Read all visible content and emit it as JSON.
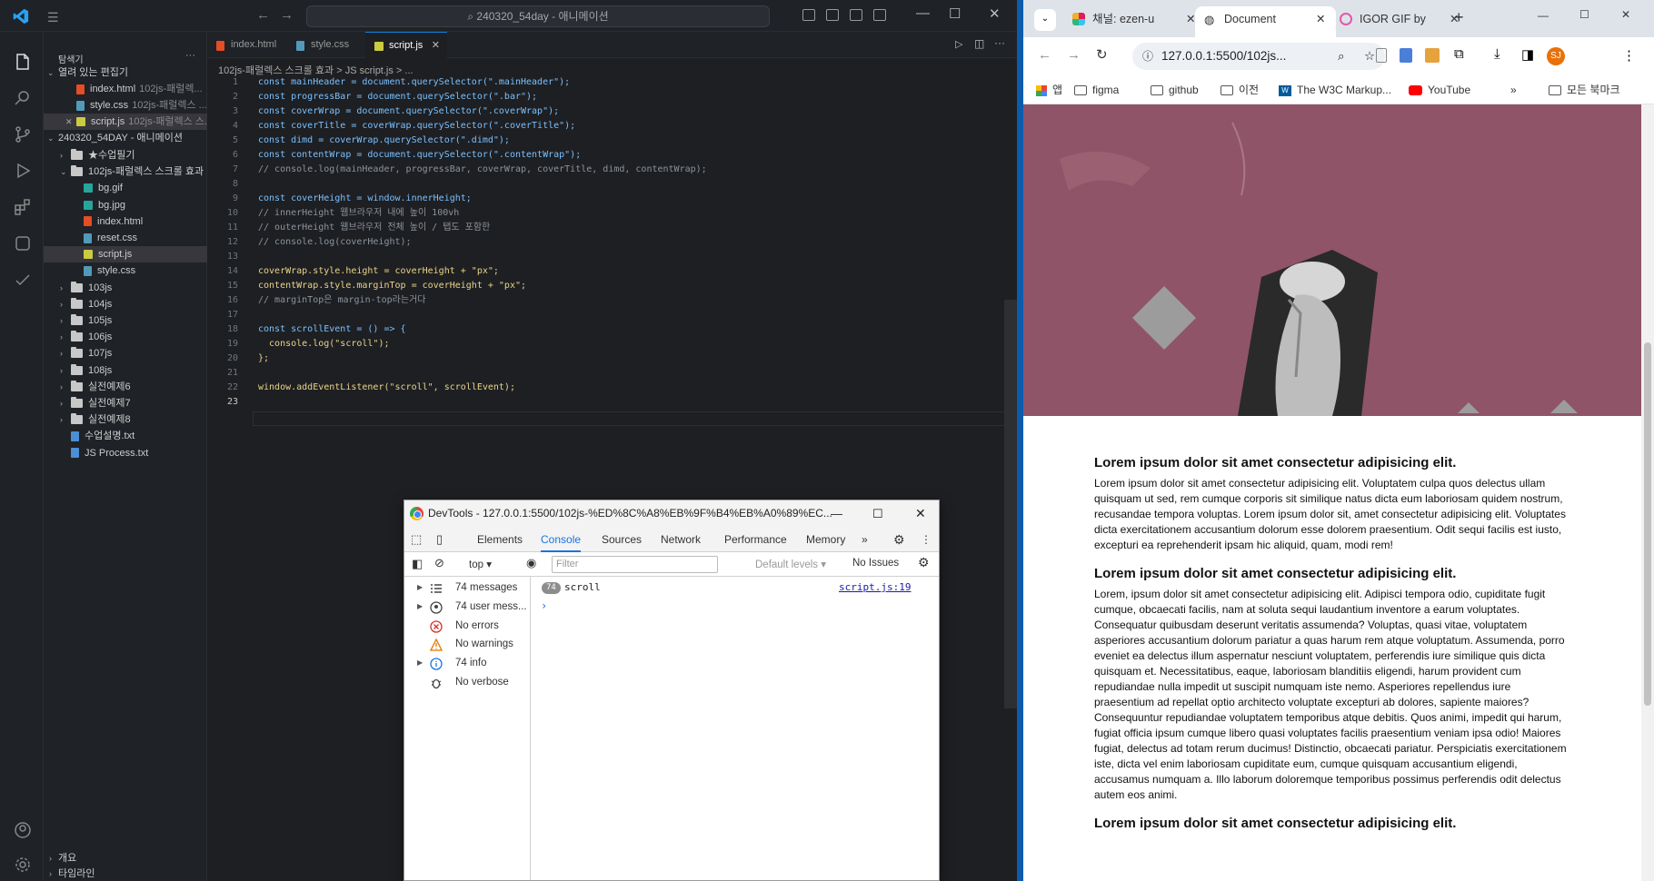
{
  "vscode": {
    "search": "240320_54day - 애니메이션",
    "sidebar": {
      "title": "탐색기",
      "open_editors_label": "열려 있는 편집기",
      "open_editors": [
        {
          "name": "index.html",
          "hint": "102js-패럴렉..."
        },
        {
          "name": "style.css",
          "hint": "102js-패럴렉스 ..."
        },
        {
          "name": "script.js",
          "hint": "102js-패럴렉스 스..."
        }
      ],
      "workspace_label": "240320_54DAY - 애니메이션",
      "tree": [
        {
          "name": "★수업필기",
          "type": "folder",
          "depth": 1
        },
        {
          "name": "102js-패럴렉스 스크롤 효과",
          "type": "folder",
          "depth": 1,
          "open": true
        },
        {
          "name": "bg.gif",
          "type": "img",
          "depth": 2
        },
        {
          "name": "bg.jpg",
          "type": "img",
          "depth": 2
        },
        {
          "name": "index.html",
          "type": "html",
          "depth": 2
        },
        {
          "name": "reset.css",
          "type": "css",
          "depth": 2
        },
        {
          "name": "script.js",
          "type": "js",
          "depth": 2,
          "selected": true
        },
        {
          "name": "style.css",
          "type": "css",
          "depth": 2
        },
        {
          "name": "103js",
          "type": "folder",
          "depth": 1
        },
        {
          "name": "104js",
          "type": "folder",
          "depth": 1
        },
        {
          "name": "105js",
          "type": "folder",
          "depth": 1
        },
        {
          "name": "106js",
          "type": "folder",
          "depth": 1
        },
        {
          "name": "107js",
          "type": "folder",
          "depth": 1
        },
        {
          "name": "108js",
          "type": "folder",
          "depth": 1
        },
        {
          "name": "실전예제6",
          "type": "folder",
          "depth": 1
        },
        {
          "name": "실전예제7",
          "type": "folder",
          "depth": 1
        },
        {
          "name": "실전예제8",
          "type": "folder",
          "depth": 1
        },
        {
          "name": "수업설명.txt",
          "type": "txt",
          "depth": 1
        },
        {
          "name": "JS Process.txt",
          "type": "txt",
          "depth": 1
        }
      ],
      "outline_label": "개요",
      "timeline_label": "타임라인"
    },
    "tabs": [
      {
        "label": "index.html",
        "type": "html"
      },
      {
        "label": "style.css",
        "type": "css"
      },
      {
        "label": "script.js",
        "type": "js",
        "active": true
      }
    ],
    "breadcrumb": "102js-패럴렉스 스크롤 효과 > JS script.js > ...",
    "code_lines": [
      "const mainHeader = document.querySelector(\".mainHeader\");",
      "const progressBar = document.querySelector(\".bar\");",
      "const coverWrap = document.querySelector(\".coverWrap\");",
      "const coverTitle = coverWrap.querySelector(\".coverTitle\");",
      "const dimd = coverWrap.querySelector(\".dimd\");",
      "const contentWrap = document.querySelector(\".contentWrap\");",
      "// console.log(mainHeader, progressBar, coverWrap, coverTitle, dimd, contentWrap);",
      "",
      "const coverHeight = window.innerHeight;",
      "// innerHeight 웹브라우저 내에 높이 100vh",
      "// outerHeight 웹브라우저 전체 높이 / 탭도 포함한",
      "// console.log(coverHeight);",
      "",
      "coverWrap.style.height = coverHeight + \"px\";",
      "contentWrap.style.marginTop = coverHeight + \"px\";",
      "// marginTop은 margin-top라는거다",
      "",
      "const scrollEvent = () => {",
      "  console.log(\"scroll\");",
      "};",
      "",
      "window.addEventListener(\"scroll\", scrollEvent);",
      ""
    ]
  },
  "devtools": {
    "title": "DevTools - 127.0.0.1:5500/102js-%ED%8C%A8%EB%9F%B4%EB%A0%89%EC...",
    "tabs": [
      "Elements",
      "Console",
      "Sources",
      "Network",
      "Performance",
      "Memory"
    ],
    "active_tab": "Console",
    "context": "top",
    "filter_placeholder": "Filter",
    "levels": "Default levels",
    "issues": "No Issues",
    "sidebar": [
      {
        "label": "74 messages",
        "icon": "list-icon"
      },
      {
        "label": "74 user mess...",
        "icon": "user-icon"
      },
      {
        "label": "No errors",
        "icon": "error-icon"
      },
      {
        "label": "No warnings",
        "icon": "warning-icon"
      },
      {
        "label": "74 info",
        "icon": "info-icon"
      },
      {
        "label": "No verbose",
        "icon": "bug-icon"
      }
    ],
    "log": {
      "count": "74",
      "message": "scroll",
      "source": "script.js:19"
    }
  },
  "chrome": {
    "tabs": [
      {
        "label": "채널: ezen-u"
      },
      {
        "label": "Document",
        "active": true
      },
      {
        "label": "IGOR GIF by"
      }
    ],
    "url": "127.0.0.1:5500/102js...",
    "profile": "SJ",
    "bookmarks": [
      "앱",
      "figma",
      "github",
      "이전",
      "The W3C Markup...",
      "YouTube"
    ],
    "all_bookmarks": "모든 북마크",
    "page": {
      "sections": [
        {
          "heading": "Lorem ipsum dolor sit amet consectetur adipisicing elit.",
          "body": "Lorem ipsum dolor sit amet consectetur adipisicing elit. Voluptatem culpa quos delectus ullam quisquam ut sed, rem cumque corporis sit similique natus dicta eum laboriosam quidem nostrum, recusandae tempora voluptas. Lorem ipsum dolor sit, amet consectetur adipisicing elit. Voluptates dicta exercitationem accusantium dolorum esse dolorem praesentium. Odit sequi facilis est iusto, excepturi ea reprehenderit ipsam hic aliquid, quam, modi rem!"
        },
        {
          "heading": "Lorem ipsum dolor sit amet consectetur adipisicing elit.",
          "body": "Lorem, ipsum dolor sit amet consectetur adipisicing elit. Adipisci tempora odio, cupiditate fugit cumque, obcaecati facilis, nam at soluta sequi laudantium inventore a earum voluptates. Consequatur quibusdam deserunt veritatis assumenda? Voluptas, quasi vitae, voluptatem asperiores accusantium dolorum pariatur a quas harum rem atque voluptatum. Assumenda, porro eveniet ea delectus illum aspernatur nesciunt voluptatem, perferendis iure similique quis dicta quisquam et. Necessitatibus, eaque, laboriosam blanditiis eligendi, harum provident cum repudiandae nulla impedit ut suscipit numquam iste nemo. Asperiores repellendus iure praesentium ad repellat optio architecto voluptate excepturi ab dolores, sapiente maiores? Consequuntur repudiandae voluptatem temporibus atque debitis. Quos animi, impedit qui harum, fugiat officia ipsum cumque libero quasi voluptates facilis praesentium veniam ipsa odio! Maiores fugiat, delectus ad totam rerum ducimus! Distinctio, obcaecati pariatur. Perspiciatis exercitationem iste, dicta vel enim laboriosam cupiditate eum, cumque quisquam accusantium eligendi, accusamus numquam a. Illo laborum doloremque temporibus possimus perferendis odit delectus autem eos animi."
        },
        {
          "heading": "Lorem ipsum dolor sit amet consectetur adipisicing elit.",
          "body": ""
        }
      ]
    }
  }
}
